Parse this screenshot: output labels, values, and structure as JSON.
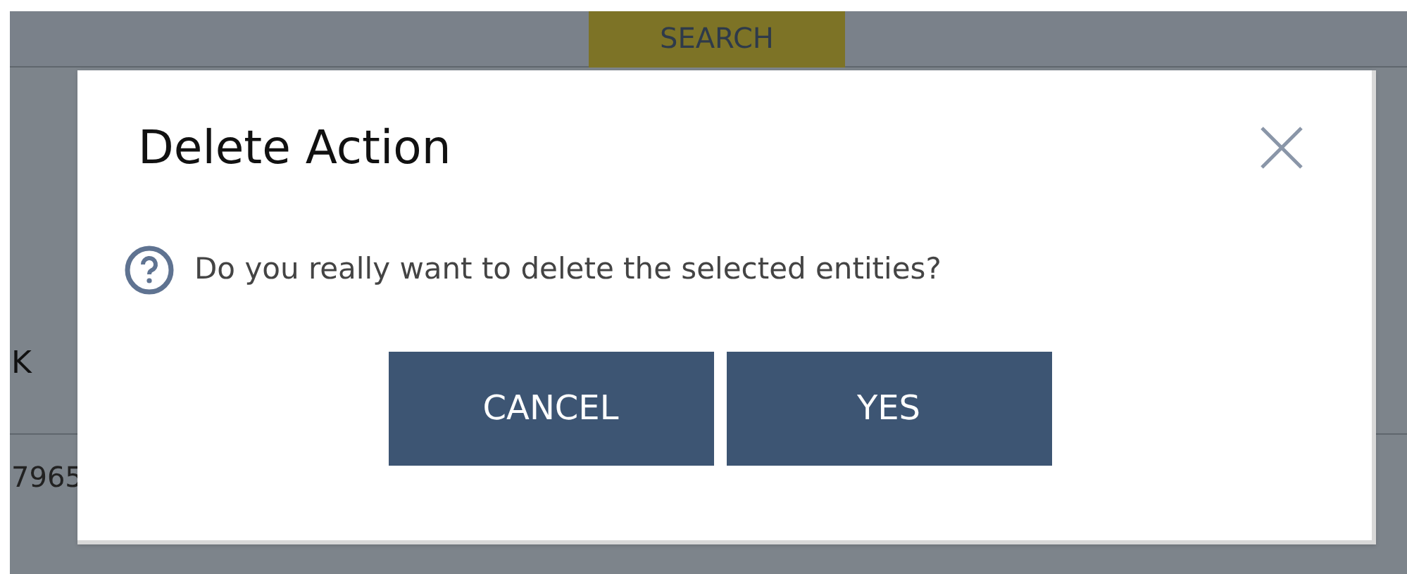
{
  "background": {
    "search_button": "SEARCH",
    "column_header": "K",
    "row_cell": "7965"
  },
  "dialog": {
    "title": "Delete Action",
    "message": "Do you really want to delete the selected entities?",
    "buttons": [
      {
        "label": "CANCEL"
      },
      {
        "label": "YES"
      }
    ]
  }
}
